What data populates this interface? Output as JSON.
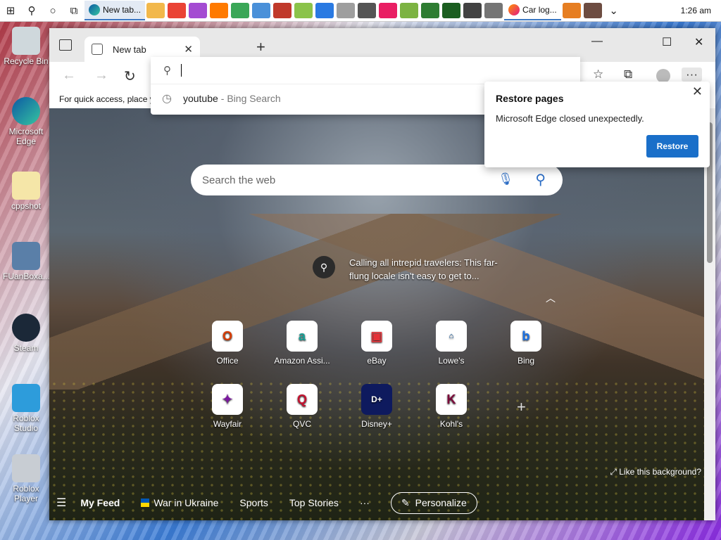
{
  "taskbar": {
    "active_tab_label": "New tab...",
    "firefox_label": "Car log...",
    "clock": "1:26 am"
  },
  "desktop_icons": [
    {
      "label": "Recycle Bin"
    },
    {
      "label": "Microsoft Edge"
    },
    {
      "label": "cppshot"
    },
    {
      "label": "FUanBoxa..."
    },
    {
      "label": "Steam"
    },
    {
      "label": "Roblox Studio"
    },
    {
      "label": "Roblox Player"
    }
  ],
  "browser": {
    "tab_title": "New tab",
    "favorites_hint": "For quick access, place y",
    "address_dropdown": {
      "suggestion": "youtube",
      "suggestion_source": "- Bing Search"
    },
    "restore_popup": {
      "title": "Restore pages",
      "message": "Microsoft Edge closed unexpectedly.",
      "button": "Restore"
    },
    "search_placeholder": "Search the web",
    "caption_line1": "Calling all intrepid travelers: This far-",
    "caption_line2": "flung locale isn't easy to get to...",
    "quick_links": [
      {
        "label": "Office",
        "glyph": "O",
        "color": "#d83b01"
      },
      {
        "label": "Amazon Assi...",
        "glyph": "a",
        "color": "#1aa197"
      },
      {
        "label": "eBay",
        "glyph": "🛍",
        "color": "#e53238"
      },
      {
        "label": "Lowe's",
        "glyph": "L",
        "color": "#004990"
      },
      {
        "label": "Bing",
        "glyph": "b",
        "color": "#1a73e8"
      },
      {
        "label": "Wayfair",
        "glyph": "✦",
        "color": "#7b189f"
      },
      {
        "label": "QVC",
        "glyph": "Q",
        "color": "#c41230"
      },
      {
        "label": "Disney+",
        "glyph": "D+",
        "color": "#0e1a5e"
      },
      {
        "label": "Kohl's",
        "glyph": "K",
        "color": "#7d0a3b"
      }
    ],
    "like_background": "Like this background?",
    "feed": {
      "my_feed": "My Feed",
      "ukraine": "War in Ukraine",
      "sports": "Sports",
      "top_stories": "Top Stories",
      "more": "···",
      "personalize": "Personalize"
    }
  }
}
